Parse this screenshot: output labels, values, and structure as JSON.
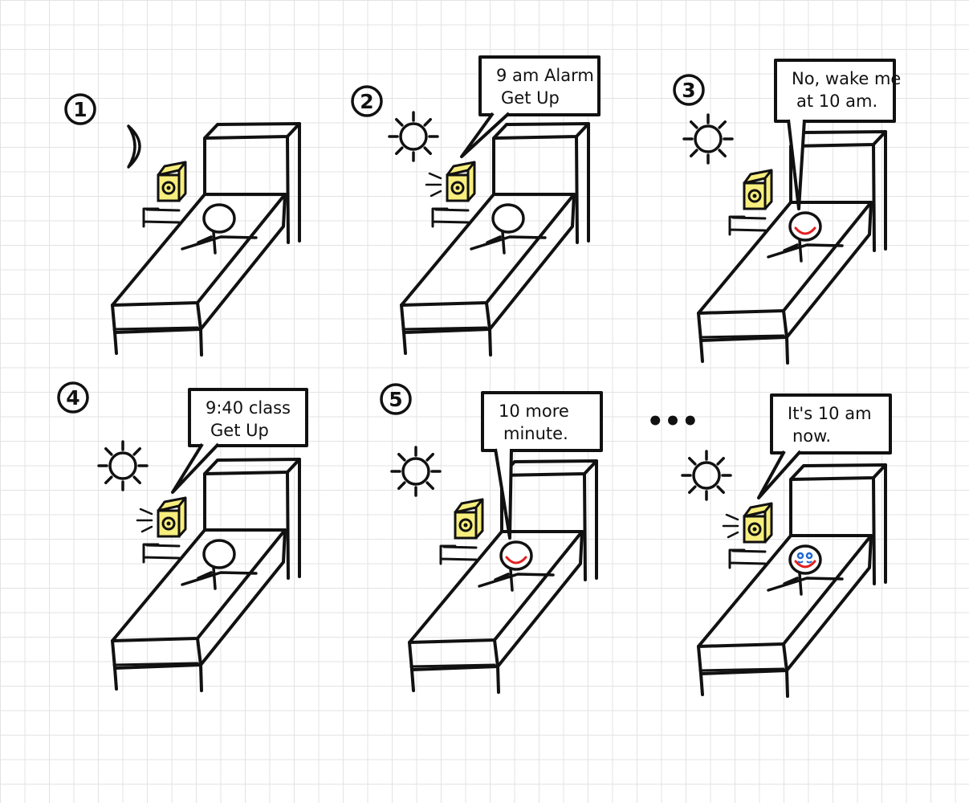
{
  "panels": [
    {
      "number": "1",
      "sky": "moon-icon",
      "speech": [],
      "speaker": "none",
      "face": "sleeping",
      "alarm_ringing": false
    },
    {
      "number": "2",
      "sky": "sun-icon",
      "speech": [
        "9 am Alarm",
        "Get Up"
      ],
      "speaker": "alarm-clock",
      "face": "sleeping",
      "alarm_ringing": true
    },
    {
      "number": "3",
      "sky": "sun-icon",
      "speech": [
        "No, wake me",
        "at 10 am."
      ],
      "speaker": "person",
      "face": "smiling",
      "alarm_ringing": false
    },
    {
      "number": "4",
      "sky": "sun-icon",
      "speech": [
        "9:40 class",
        "Get Up"
      ],
      "speaker": "alarm-clock",
      "face": "sleeping",
      "alarm_ringing": true
    },
    {
      "number": "5",
      "sky": "sun-icon",
      "speech": [
        "10 more",
        "minute."
      ],
      "speaker": "person",
      "face": "smiling",
      "alarm_ringing": false
    },
    {
      "number": "",
      "sky": "sun-icon",
      "speech": [
        "It's 10 am",
        "now."
      ],
      "speaker": "alarm-clock",
      "face": "crying",
      "alarm_ringing": true
    }
  ],
  "ellipsis": "•••",
  "colors": {
    "ink": "#111111",
    "clock_fill": "#f7ee7e",
    "mouth": "#e02020",
    "tears": "#1f67d1",
    "grid": "#e3e3e3"
  }
}
